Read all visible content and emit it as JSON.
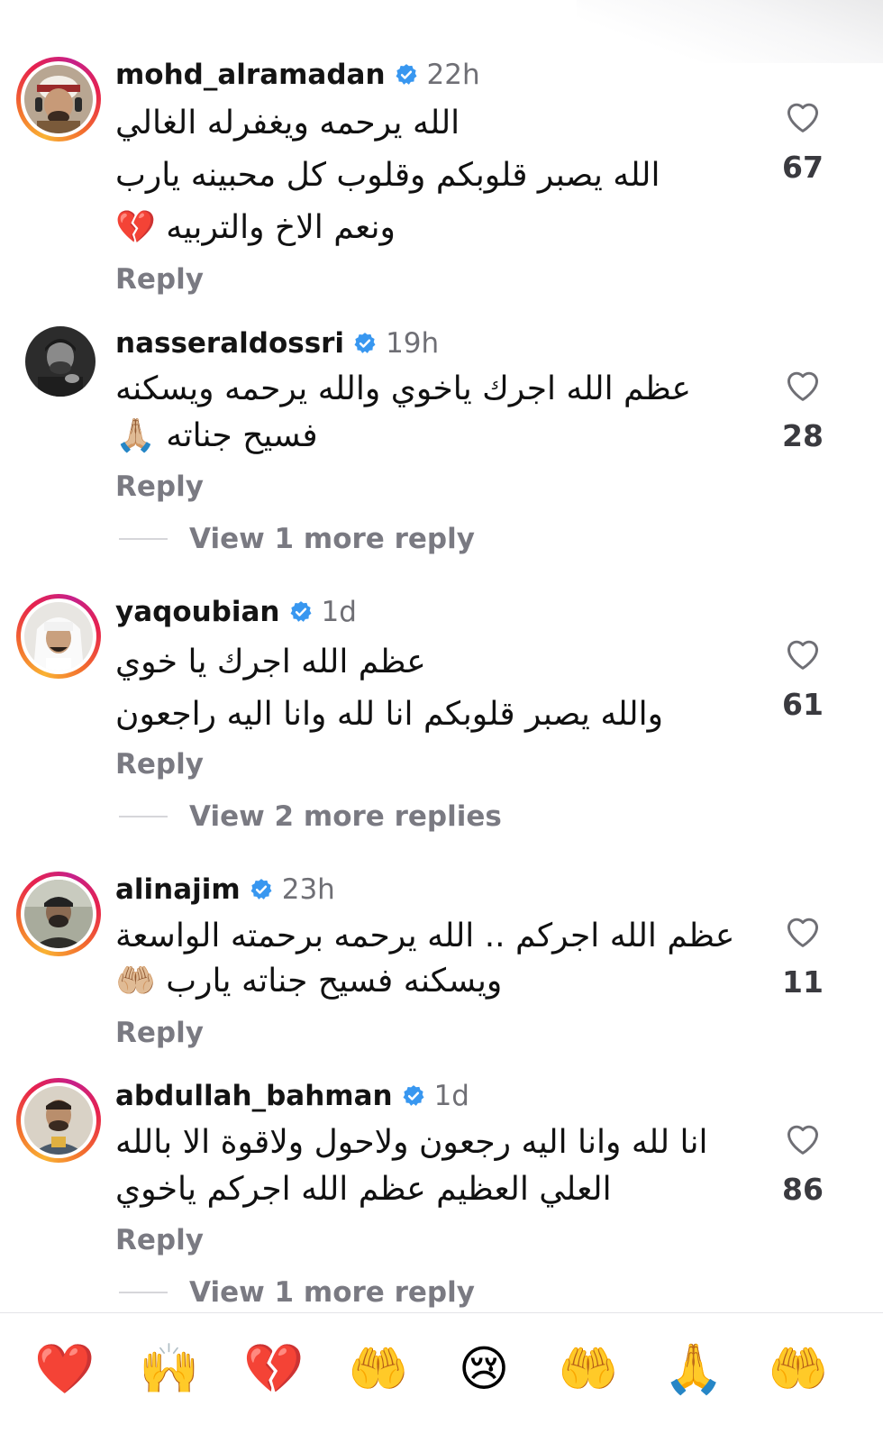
{
  "comments": [
    {
      "username": "mohd_alramadan",
      "time": "22h",
      "lines": [
        "الله يرحمه ويغفرله الغالي",
        "الله يصبر قلوبكم وقلوب كل محبينه يارب",
        "ونعم الاخ والتربيه 💔"
      ],
      "reply": "Reply",
      "likes": "67",
      "more_replies": ""
    },
    {
      "username": "nasseraldossri",
      "time": "19h",
      "lines": [
        "عظم الله اجرك ياخوي والله يرحمه ويسكنه",
        "فسيح جناته 🙏🏼"
      ],
      "reply": "Reply",
      "likes": "28",
      "more_replies": "View 1 more reply"
    },
    {
      "username": "yaqoubian",
      "time": "1d",
      "lines": [
        "عظم الله اجرك يا خوي",
        "والله يصبر قلوبكم انا لله وانا اليه راجعون"
      ],
      "reply": "Reply",
      "likes": "61",
      "more_replies": "View 2 more replies"
    },
    {
      "username": "alinajim",
      "time": "23h",
      "lines": [
        "عظم الله اجركم .. الله يرحمه برحمته الواسعة",
        "ويسكنه فسيح جناته يارب 🤲🏼"
      ],
      "reply": "Reply",
      "likes": "11",
      "more_replies": ""
    },
    {
      "username": "abdullah_bahman",
      "time": "1d",
      "lines": [
        "انا لله وانا اليه رجعون ولاحول ولاقوة الا بالله",
        "العلي العظيم عظم الله اجركم ياخوي"
      ],
      "reply": "Reply",
      "likes": "86",
      "more_replies": "View 1 more reply"
    }
  ],
  "quick_reactions": [
    "❤️",
    "🙌",
    "💔",
    "🤲",
    "😢",
    "🤲",
    "🙏",
    "🤲"
  ],
  "colors": {
    "verified": "#3897f0",
    "secondary_text": "#7a7a82",
    "story_ring": [
      "#f9b233",
      "#e7224d",
      "#c6218a"
    ]
  },
  "icons": {
    "like": "heart-outline-icon",
    "verified": "verified-badge-icon"
  }
}
